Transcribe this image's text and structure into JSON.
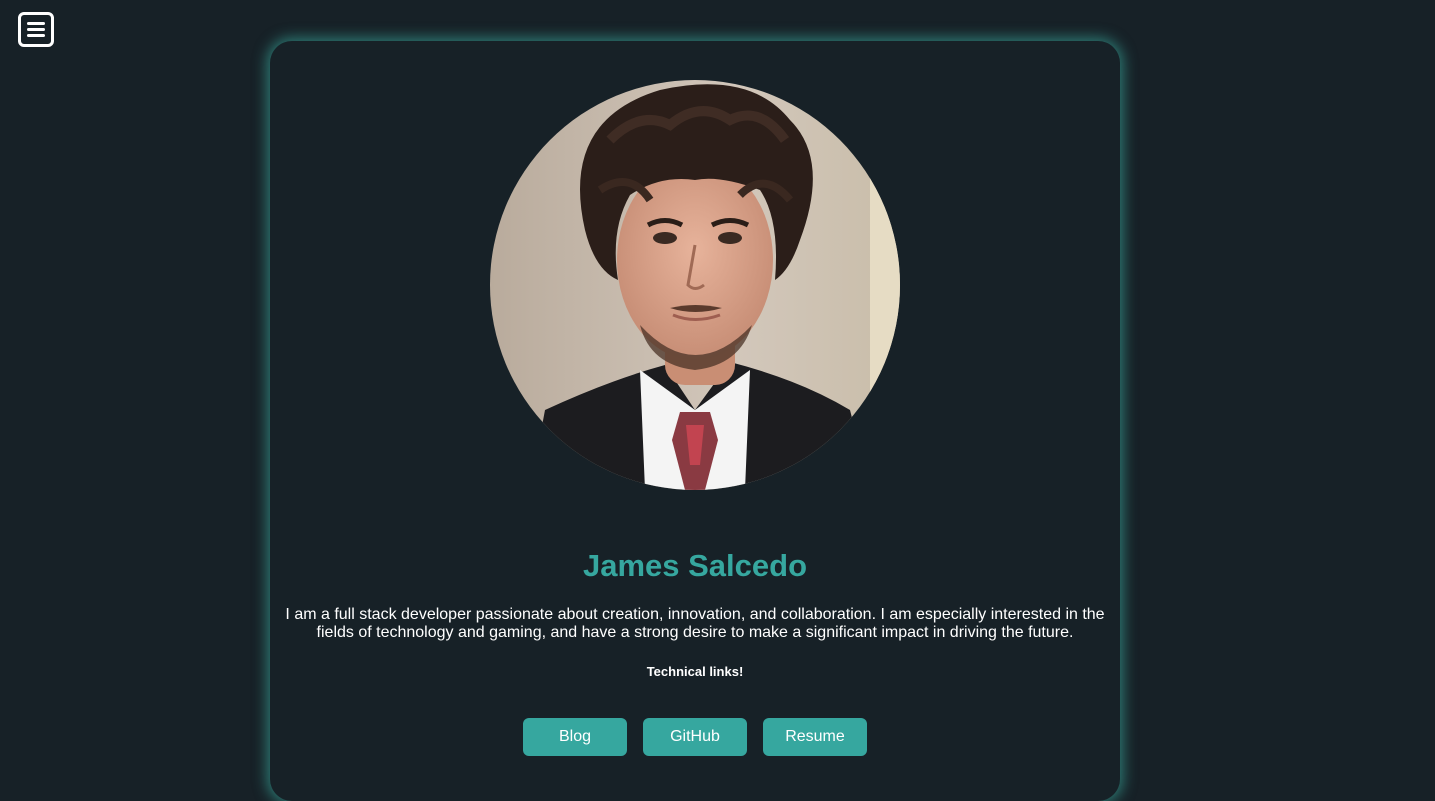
{
  "nav": {
    "menu_icon": "hamburger-menu-icon"
  },
  "profile": {
    "photo": "portrait-photo",
    "name": "James Salcedo",
    "bio": "I am a full stack developer passionate about creation, innovation, and collaboration. I am especially interested in the fields of technology and gaming, and have a strong desire to make a significant impact in driving the future.",
    "links_heading": "Technical links!"
  },
  "links": {
    "blog_label": "Blog",
    "github_label": "GitHub",
    "resume_label": "Resume"
  },
  "colors": {
    "background": "#172127",
    "accent": "#36a79f",
    "glow": "#40c4b4",
    "text": "#ffffff"
  }
}
